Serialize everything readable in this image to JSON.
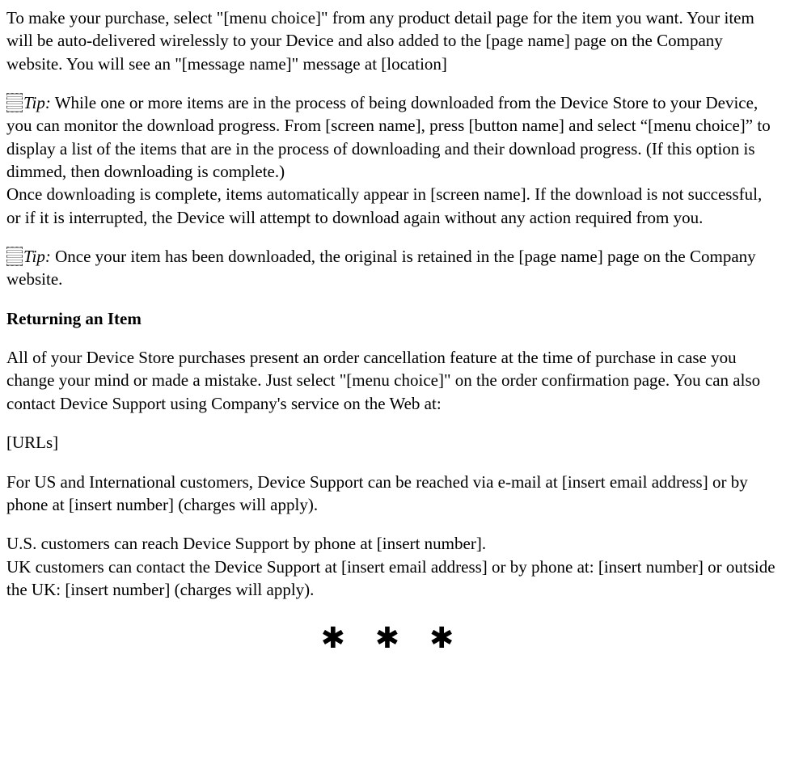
{
  "paragraphs": {
    "intro": "To make your purchase, select \"[menu choice]\" from any product detail page for the item you want. Your item will be auto-delivered wirelessly to your Device and also added to the [page name] page on the Company website. You will see an \"[message name]\" message at [location]",
    "tip1_label": "Tip:",
    "tip1_body": " While one or more items are in the process of being downloaded from the Device Store to your Device, you can monitor the download progress. From [screen name], press [button name] and select “[menu choice]” to display a list of the items that are in the process of downloading and their download progress. (If this option is dimmed, then downloading is complete.)",
    "tip1_after": "Once downloading is complete, items automatically appear in [screen name]. If the download is not successful, or if it is interrupted, the Device will attempt to download again without any action required from you.",
    "tip2_label": "Tip:",
    "tip2_body": " Once your item has been downloaded, the original is retained in the [page name] page on the Company website.",
    "heading_return": "Returning an Item",
    "return_p1": "All of your Device Store purchases present an order cancellation feature at the time of purchase in case you change your mind or made a mistake. Just select \"[menu choice]\" on the order confirmation page. You can also contact Device Support using Company's service on the Web at:",
    "urls": "[URLs]",
    "return_p2": "For US and International customers, Device Support can be reached via e-mail at [insert email address] or by phone at [insert number] (charges will apply).",
    "return_p3a": "U.S. customers can reach Device Support by phone at [insert number].",
    "return_p3b": "UK customers can contact the Device Support at [insert email address] or by phone at: [insert number] or outside the UK: [insert number] (charges will apply).",
    "asterism": "✱ ✱ ✱"
  }
}
